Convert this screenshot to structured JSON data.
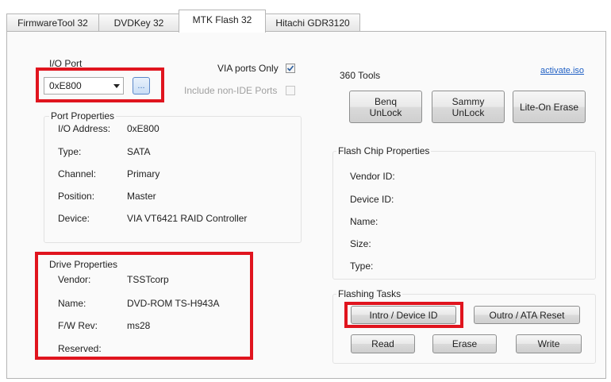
{
  "tabs": [
    {
      "label": "FirmwareTool 32"
    },
    {
      "label": "DVDKey 32"
    },
    {
      "label": "MTK Flash 32"
    },
    {
      "label": "Hitachi GDR3120"
    }
  ],
  "io_port": {
    "label": "I/O Port",
    "selected": "0xE800",
    "browse_label": "...",
    "via_only_label": "VIA ports Only",
    "via_only_checked": true,
    "include_non_ide_label": "Include non-IDE Ports",
    "include_non_ide_checked": false
  },
  "port_properties": {
    "title": "Port Properties",
    "rows": [
      {
        "label": "I/O Address:",
        "value": "0xE800"
      },
      {
        "label": "Type:",
        "value": "SATA"
      },
      {
        "label": "Channel:",
        "value": "Primary"
      },
      {
        "label": "Position:",
        "value": "Master"
      },
      {
        "label": "Device:",
        "value": "VIA VT6421 RAID Controller"
      }
    ]
  },
  "drive_properties": {
    "title": "Drive Properties",
    "rows": [
      {
        "label": "Vendor:",
        "value": "TSSTcorp"
      },
      {
        "label": "Name:",
        "value": "DVD-ROM TS-H943A"
      },
      {
        "label": "F/W Rev:",
        "value": "ms28"
      },
      {
        "label": "Reserved:",
        "value": ""
      }
    ]
  },
  "activate_link": "activate.iso",
  "tools_360": {
    "title": "360 Tools",
    "benq_label_1": "Benq",
    "benq_label_2": "UnLock",
    "sammy_label_1": "Sammy",
    "sammy_label_2": "UnLock",
    "liteon_label": "Lite-On Erase"
  },
  "flash_chip": {
    "title": "Flash Chip Properties",
    "rows": [
      {
        "label": "Vendor ID:"
      },
      {
        "label": "Device ID:"
      },
      {
        "label": "Name:"
      },
      {
        "label": "Size:"
      },
      {
        "label": "Type:"
      }
    ]
  },
  "flashing_tasks": {
    "title": "Flashing Tasks",
    "intro_label": "Intro / Device ID",
    "outro_label": "Outro / ATA Reset",
    "read_label": "Read",
    "erase_label": "Erase",
    "write_label": "Write"
  },
  "colors": {
    "highlight": "#e0141e",
    "link": "#1f5fc4"
  }
}
